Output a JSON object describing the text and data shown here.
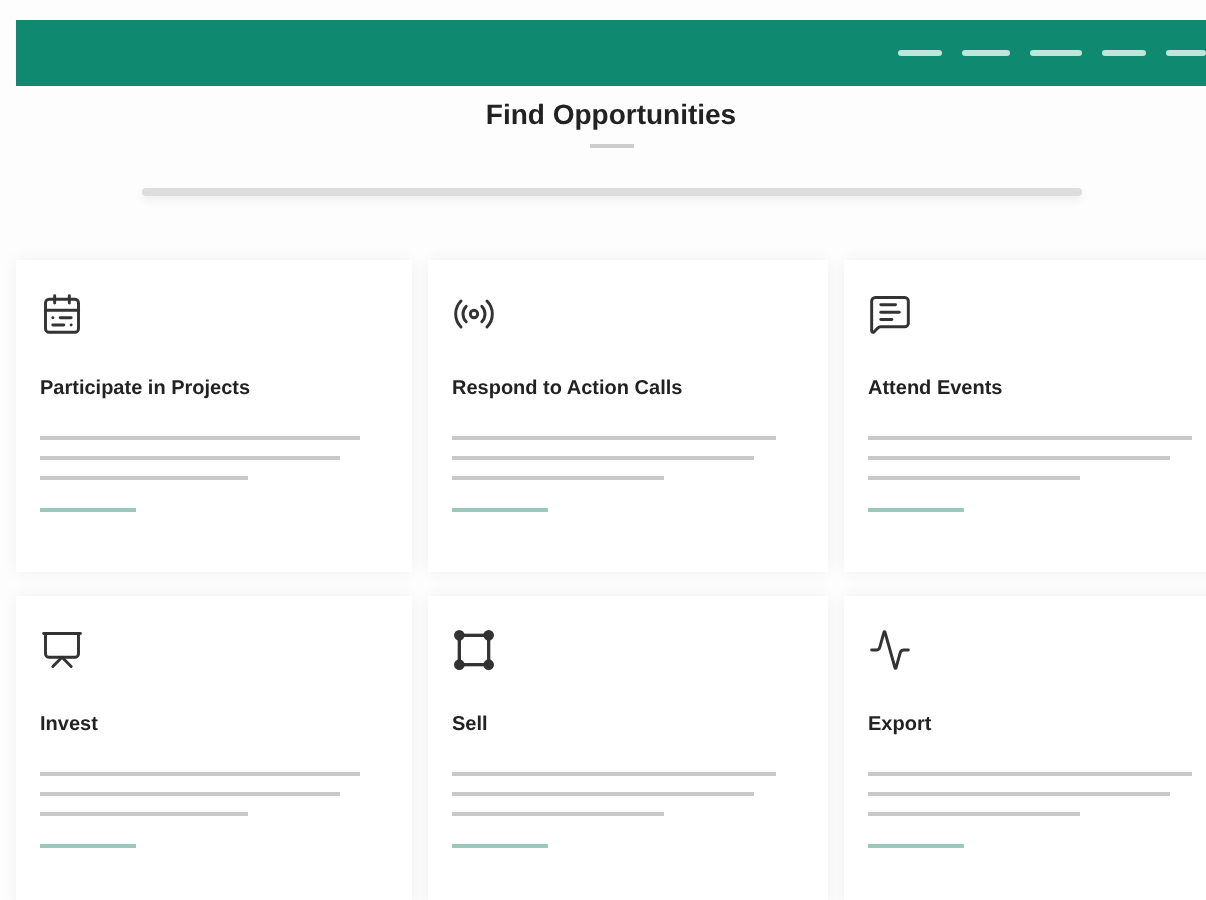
{
  "page": {
    "title": "Find Opportunities"
  },
  "cards": [
    {
      "title": "Participate in Projects"
    },
    {
      "title": "Respond to Action Calls"
    },
    {
      "title": "Attend Events"
    },
    {
      "title": "Invest"
    },
    {
      "title": "Sell"
    },
    {
      "title": "Export"
    }
  ]
}
